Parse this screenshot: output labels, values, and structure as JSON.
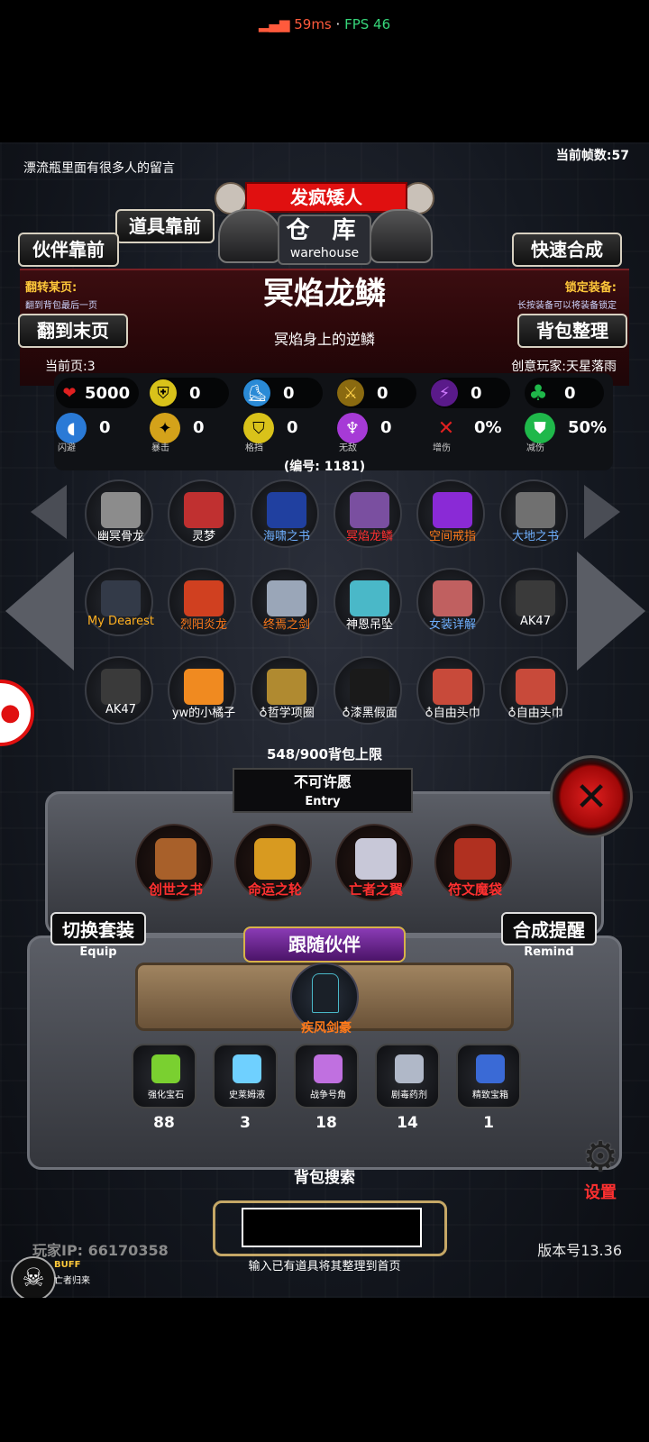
{
  "statusbar": {
    "signal_icon": "signal-bars-icon",
    "ping": "59ms",
    "separator": "·",
    "fps": "FPS 46"
  },
  "header": {
    "message": "漂流瓶里面有很多人的留言",
    "frame_count": "当前帧数:57",
    "banner": "发疯矮人",
    "warehouse_cn": "仓 库",
    "warehouse_en": "warehouse"
  },
  "nav": {
    "items_front": "道具靠前",
    "partner_front": "伙伴靠前",
    "quick_synth": "快速合成",
    "flip_last": "翻到末页",
    "bag_sort": "背包整理",
    "flip_page_label": "翻转某页:",
    "flip_page_sub": "翻到背包最后一页",
    "lock_label": "锁定装备:",
    "lock_sub": "长按装备可以将装备锁定"
  },
  "item": {
    "name": "冥焰龙鳞",
    "desc": "冥焰身上的逆鳞",
    "current_page": "当前页:3",
    "creator": "创意玩家:天星落雨",
    "serial": "(编号: 1181)"
  },
  "stats_row1": [
    {
      "icon": "heart-icon",
      "value": "5000",
      "color": "#e02020"
    },
    {
      "icon": "armor-icon",
      "value": "0",
      "color": "#d9c21a"
    },
    {
      "icon": "boot-icon",
      "value": "0",
      "color": "#2a8ad6"
    },
    {
      "icon": "sword-icon",
      "value": "0",
      "color": "#c89a1a"
    },
    {
      "icon": "lightning-icon",
      "value": "0",
      "color": "#9b3ad6"
    },
    {
      "icon": "clover-icon",
      "value": "0",
      "color": "#1fb84a"
    }
  ],
  "stats_row2": [
    {
      "icon": "dodge-icon",
      "value": "0",
      "caption": "闪避",
      "color": "#2a7ad6"
    },
    {
      "icon": "crit-icon",
      "value": "0",
      "caption": "暴击",
      "color": "#d4a21a"
    },
    {
      "icon": "shield-icon",
      "value": "0",
      "caption": "格挡",
      "color": "#d9c21a"
    },
    {
      "icon": "wings-icon",
      "value": "0",
      "caption": "无敌",
      "color": "#a63ad6"
    },
    {
      "icon": "damage-up-icon",
      "value": "0%",
      "caption": "增伤",
      "color": "#e02020"
    },
    {
      "icon": "damage-down-icon",
      "value": "50%",
      "caption": "减伤",
      "color": "#1fb84a"
    }
  ],
  "inventory": [
    {
      "name": "幽冥骨龙",
      "color": "#ffffff",
      "art": "#8c8c8c"
    },
    {
      "name": "灵梦",
      "color": "#ffffff",
      "art": "#c03030"
    },
    {
      "name": "海啸之书",
      "color": "#6fb0ff",
      "art": "#2040a0"
    },
    {
      "name": "冥焰龙鳞",
      "color": "#ff3030",
      "art": "#7a4fa0"
    },
    {
      "name": "空间戒指",
      "color": "#ff7a1a",
      "art": "#8a2ad6"
    },
    {
      "name": "大地之书",
      "color": "#6fb0ff",
      "art": "#707070"
    },
    {
      "name": "My Dearest",
      "color": "#ffb020",
      "art": "#333a48"
    },
    {
      "name": "烈阳炎龙",
      "color": "#ff7a1a",
      "art": "#d04020"
    },
    {
      "name": "终焉之剑",
      "color": "#ff7a1a",
      "art": "#9aa6b8"
    },
    {
      "name": "神恩吊坠",
      "color": "#ffffff",
      "art": "#4ab8c8"
    },
    {
      "name": "女装详解",
      "color": "#6fb0ff",
      "art": "#c06060"
    },
    {
      "name": "AK47",
      "color": "#ffffff",
      "art": "#3a3a3a"
    },
    {
      "name": "AK47",
      "color": "#ffffff",
      "art": "#3a3a3a"
    },
    {
      "name": "yw的小橘子",
      "color": "#ffffff",
      "art": "#f08a20"
    },
    {
      "name": "♁哲学项圈",
      "color": "#ffffff",
      "art": "#b08a30"
    },
    {
      "name": "♁漆黑假面",
      "color": "#ffffff",
      "art": "#1a1a1a"
    },
    {
      "name": "♁自由头巾",
      "color": "#ffffff",
      "art": "#c84a3a"
    },
    {
      "name": "♁自由头巾",
      "color": "#ffffff",
      "art": "#c84a3a"
    }
  ],
  "capacity": "548/900背包上限",
  "wish": {
    "title": "不可许愿",
    "entry": "Entry"
  },
  "special_items": [
    {
      "name": "创世之书",
      "art": "#a8602a"
    },
    {
      "name": "命运之轮",
      "art": "#d89a20"
    },
    {
      "name": "亡者之翼",
      "art": "#c8c8d8"
    },
    {
      "name": "符文魔袋",
      "art": "#b03020"
    }
  ],
  "equip": {
    "label": "切换套装",
    "sub": "Equip"
  },
  "remind": {
    "label": "合成提醒",
    "sub": "Remind"
  },
  "follow": {
    "label": "跟随伙伴",
    "companion": "疾风剑豪"
  },
  "consumables": [
    {
      "name": "强化宝石",
      "qty": "88",
      "art": "#7ad030"
    },
    {
      "name": "史莱姆液",
      "qty": "3",
      "art": "#6fd0ff"
    },
    {
      "name": "战争号角",
      "qty": "18",
      "art": "#c070e0"
    },
    {
      "name": "剧毒药剂",
      "qty": "14",
      "art": "#b0b8c8"
    },
    {
      "name": "精致宝箱",
      "qty": "1",
      "art": "#3a6ad6"
    }
  ],
  "search": {
    "label": "背包搜索",
    "hint": "输入已有道具将其整理到首页",
    "value": ""
  },
  "settings": {
    "label": "设置"
  },
  "buff": {
    "label": "BUFF",
    "sub": "亡者归来"
  },
  "footer": {
    "player_ip": "玩家IP: 66170358",
    "version": "版本号13.36"
  }
}
